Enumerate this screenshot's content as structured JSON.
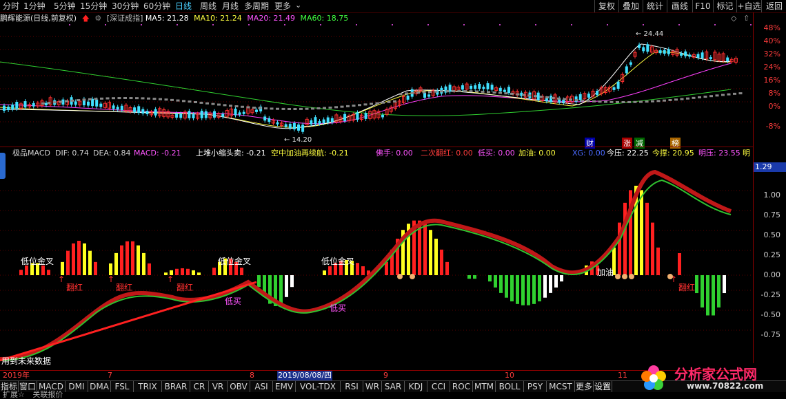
{
  "top_tabs": [
    "分时",
    "1分钟",
    "5分钟",
    "15分钟",
    "30分钟",
    "60分钟",
    "日线",
    "周线",
    "月线",
    "多周期",
    "更多"
  ],
  "top_tab_active": "日线",
  "top_right_buttons": [
    "复权",
    "叠加",
    "统计",
    "画线",
    "F10",
    "标记",
    "+自选",
    "返回"
  ],
  "info": {
    "title": "鹏辉能源(日线,前复权)",
    "index": "[深证成指]",
    "ma5": "MA5: 21.28",
    "ma10": "MA10: 21.24",
    "ma20": "MA20: 21.49",
    "ma60": "MA60: 18.75"
  },
  "price_axis": [
    "48%",
    "40%",
    "32%",
    "24%",
    "16%",
    "8%",
    "0%",
    "-8%"
  ],
  "price_annotations": {
    "high": "24.44",
    "low": "14.20"
  },
  "event_tags": [
    "财",
    "涨",
    "减",
    "榜"
  ],
  "macd_header": [
    {
      "text": "极品MACD",
      "color": "#d0d0d0"
    },
    {
      "text": "DIF: 0.74",
      "color": "#d0d0d0"
    },
    {
      "text": "DEA: 0.84",
      "color": "#d0d0d0"
    },
    {
      "text": "MACD: -0.21",
      "color": "#ff55ff"
    },
    {
      "text": "上堆小缩头卖: -0.21",
      "color": "#ffffff"
    },
    {
      "text": "空中加油再续航: -0.21",
      "color": "#ffff40"
    },
    {
      "text": "佛手: 0.00",
      "color": "#ff55ff"
    },
    {
      "text": "二次翻红: 0.00",
      "color": "#ff3c3c"
    },
    {
      "text": "低买: 0.00",
      "color": "#ff55ff"
    },
    {
      "text": "加油: 0.00",
      "color": "#ffff40"
    },
    {
      "text": "XG: 0.00",
      "color": "#4a6aff"
    },
    {
      "text": "今压: 22.25",
      "color": "#ffffff"
    },
    {
      "text": "今撑: 20.95",
      "color": "#ffff40"
    },
    {
      "text": "明压: 23.55",
      "color": "#ff55ff"
    },
    {
      "text": "明",
      "color": "#ffff40"
    }
  ],
  "macd_axis": [
    "1.29",
    "1.00",
    "0.75",
    "0.50",
    "0.25",
    "0.00",
    "-0.25",
    "-0.50",
    "-0.75"
  ],
  "macd_labels": {
    "golden_cross": "低位金叉",
    "turn_red": "翻红",
    "low_buy": "低买",
    "refuel": "加油",
    "note": "用到未来数据"
  },
  "date_axis": [
    "2019年",
    "7",
    "8",
    "9",
    "10",
    "11"
  ],
  "date_highlight": "2019/08/08/四",
  "index_tabs": [
    "指标",
    "窗口",
    "MACD",
    "DMI",
    "DMA",
    "FSL",
    "TRIX",
    "BRAR",
    "CR",
    "VR",
    "OBV",
    "ASI",
    "EMV",
    "VOL-TDX",
    "RSI",
    "WR",
    "SAR",
    "KDJ",
    "CCI",
    "ROC",
    "MTM",
    "BOLL",
    "PSY",
    "MCST",
    "更多",
    "设置"
  ],
  "bottom_text": [
    "扩展☆",
    "关联报价"
  ],
  "watermark": {
    "text": "分析家公式网",
    "url": "www.70822.com"
  }
}
